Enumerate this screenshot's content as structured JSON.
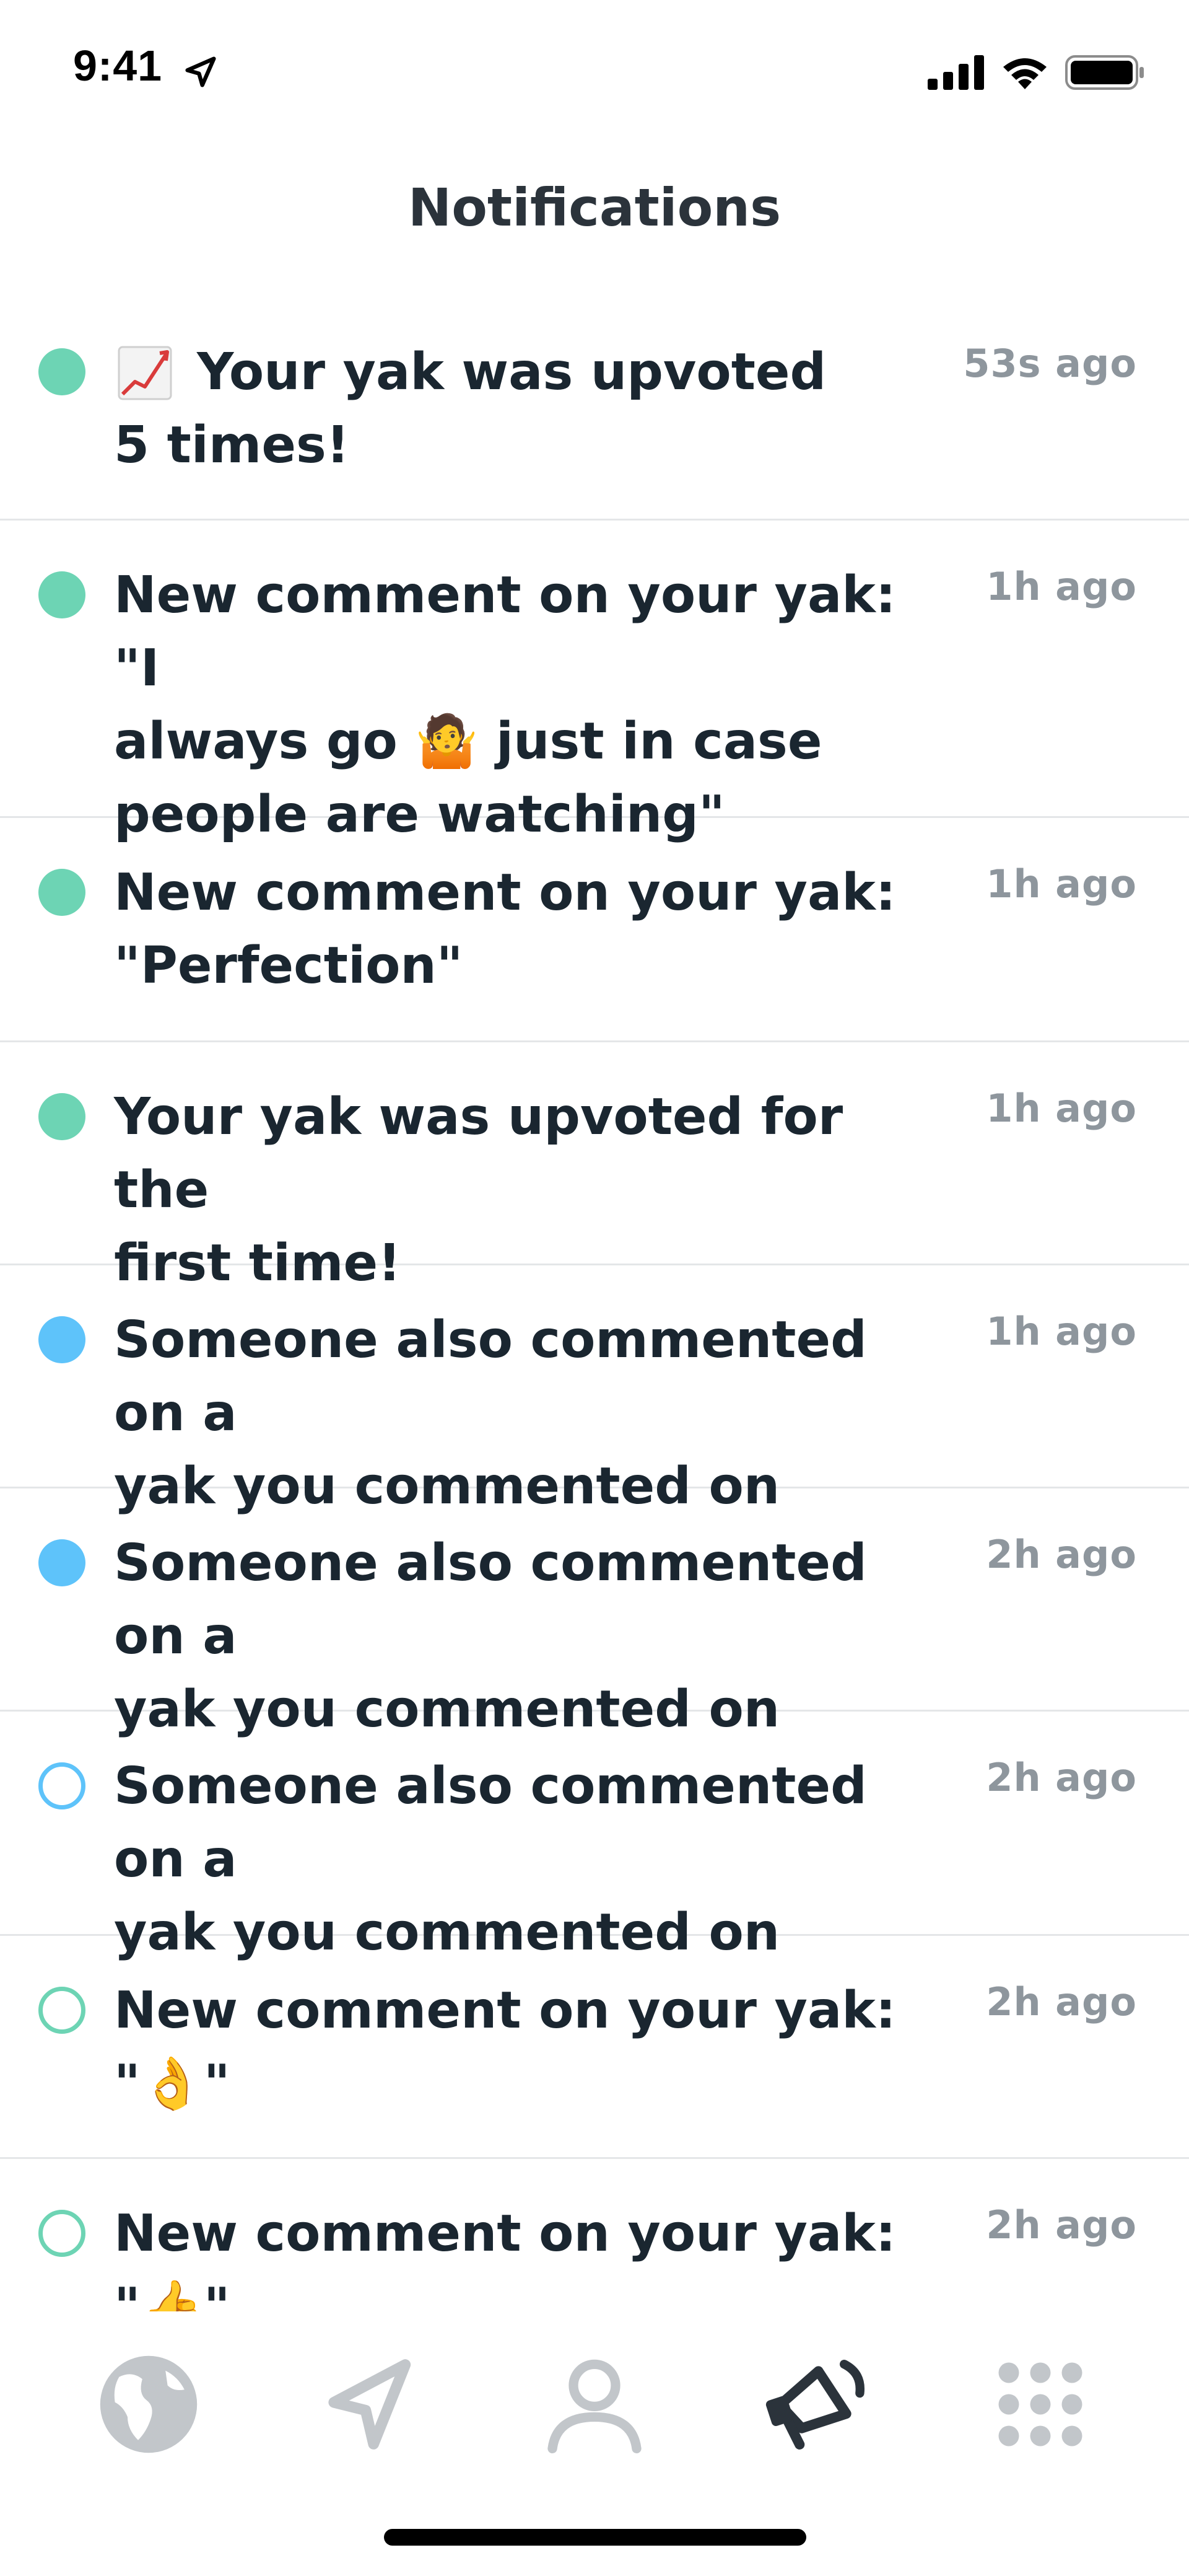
{
  "status_bar": {
    "time": "9:41",
    "icons": [
      "location-arrow-icon",
      "cellular-signal-icon",
      "wifi-icon",
      "battery-icon"
    ]
  },
  "header": {
    "title": "Notifications"
  },
  "colors": {
    "unread_green": "#6dd4b4",
    "unread_blue": "#5ec3fa",
    "read_outline_blue": "#5ec3fa",
    "read_outline_green": "#6dd4b4",
    "title_text": "#2b333b",
    "body_text": "#1a2630",
    "timestamp_text": "#8e969d",
    "divider": "#e4e6e8",
    "active_tab": "#2b333b",
    "inactive_tab": "#c2c6ca"
  },
  "notifications": [
    {
      "icon": "chart-increasing-icon",
      "text": "Your yak was upvoted\n5 times!",
      "time": "53s ago",
      "dot": "filled-green"
    },
    {
      "text": "New comment on your yak: \"I\nalways go 🤷 just in case\npeople are watching\"",
      "time": "1h ago",
      "dot": "filled-green"
    },
    {
      "text": "New comment on your yak:\n\"Perfection\"",
      "time": "1h ago",
      "dot": "filled-green"
    },
    {
      "text": "Your yak was upvoted for the\nfirst time!",
      "time": "1h ago",
      "dot": "filled-green"
    },
    {
      "text": "Someone also commented on a\nyak you commented on",
      "time": "1h ago",
      "dot": "filled-blue"
    },
    {
      "text": "Someone also commented on a\nyak you commented on",
      "time": "2h ago",
      "dot": "filled-blue"
    },
    {
      "text": "Someone also commented on a\nyak you commented on",
      "time": "2h ago",
      "dot": "outline-blue"
    },
    {
      "text": "New comment on your yak:\n\"👌\"",
      "time": "2h ago",
      "dot": "outline-green"
    },
    {
      "text": "New comment on your yak:\n\"👍\"",
      "time": "2h ago",
      "dot": "outline-green"
    }
  ],
  "tab_bar": {
    "tabs": [
      {
        "icon": "globe-icon",
        "active": false
      },
      {
        "icon": "send-paper-plane-icon",
        "active": false
      },
      {
        "icon": "profile-icon",
        "active": false
      },
      {
        "icon": "megaphone-icon",
        "active": true
      },
      {
        "icon": "more-grid-icon",
        "active": false
      }
    ]
  }
}
